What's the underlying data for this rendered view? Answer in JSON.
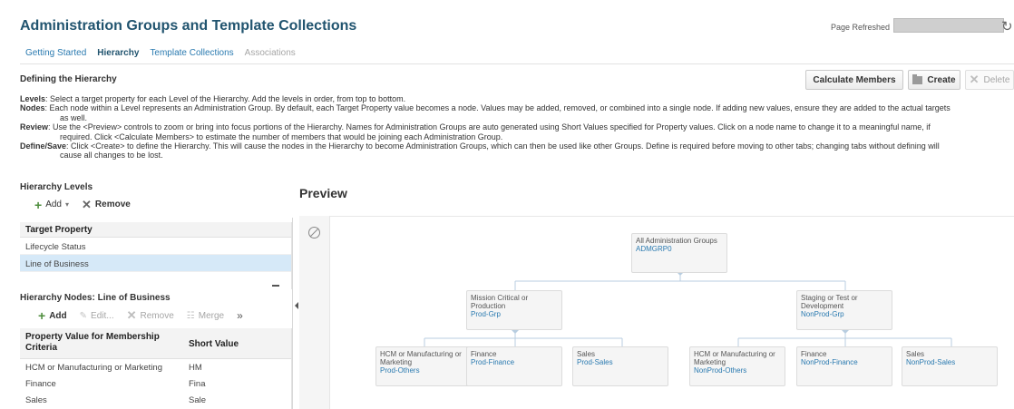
{
  "header": {
    "title": "Administration Groups and Template Collections",
    "page_refreshed_label": "Page Refreshed"
  },
  "tabs": [
    {
      "label": "Getting Started",
      "state": "normal"
    },
    {
      "label": "Hierarchy",
      "state": "active"
    },
    {
      "label": "Template Collections",
      "state": "normal"
    },
    {
      "label": "Associations",
      "state": "disabled"
    }
  ],
  "defining": {
    "title": "Defining the Hierarchy",
    "buttons": {
      "calculate": "Calculate Members",
      "create": "Create",
      "delete": "Delete"
    },
    "instructions": {
      "levels": {
        "term": "Levels",
        "text": ": Select a target property for each Level of the Hierarchy. Add the levels in order, from top to bottom."
      },
      "nodes": {
        "term": "Nodes",
        "text": ": Each node within a Level represents an Administration Group. By default, each Target Property value becomes a node. Values may be added, removed, or combined into a single node. If adding new values, ensure they are added to the actual targets",
        "cont": "as well."
      },
      "review": {
        "term": "Review",
        "text": ": Use the <Preview> controls to zoom or bring into focus portions of the Hierarchy. Names for Administration Groups are auto generated using Short Values specified for Property values. Click on a node name to change it to a meaningful name, if",
        "cont": "required. Click <Calculate Members> to estimate the number of members that would be joining each Administration Group."
      },
      "define": {
        "term": "Define/Save",
        "text": ": Click <Create> to define the Hierarchy. This will cause the nodes in the Hierarchy to become Administration Groups, which can then be used like other Groups. Define is required before moving to other tabs; changing tabs without defining will",
        "cont": "cause all changes to be lost."
      }
    }
  },
  "levels": {
    "title": "Hierarchy Levels",
    "toolbar": {
      "add": "Add",
      "remove": "Remove"
    },
    "column": "Target Property",
    "rows": [
      "Lifecycle Status",
      "Line of Business"
    ],
    "selected_index": 1
  },
  "nodes": {
    "title": "Hierarchy Nodes: Line of Business",
    "toolbar": {
      "add": "Add",
      "edit": "Edit...",
      "remove": "Remove",
      "merge": "Merge",
      "more": "»"
    },
    "columns": [
      "Property Value for Membership Criteria",
      "Short Value"
    ],
    "rows": [
      [
        "HCM or Manufacturing or Marketing",
        "HM"
      ],
      [
        "Finance",
        "Fina"
      ],
      [
        "Sales",
        "Sale"
      ]
    ]
  },
  "preview": {
    "title": "Preview",
    "root": {
      "name": "All Administration Groups",
      "id": "ADMGRP0"
    },
    "level1": [
      {
        "name": "Mission Critical or Production",
        "id": "Prod-Grp"
      },
      {
        "name": "Staging or Test or Development",
        "id": "NonProd-Grp"
      }
    ],
    "level2": [
      {
        "name": "HCM or Manufacturing or Marketing",
        "id": "Prod-Others"
      },
      {
        "name": "Finance",
        "id": "Prod-Finance"
      },
      {
        "name": "Sales",
        "id": "Prod-Sales"
      },
      {
        "name": "HCM or Manufacturing or Marketing",
        "id": "NonProd-Others"
      },
      {
        "name": "Finance",
        "id": "NonProd-Finance"
      },
      {
        "name": "Sales",
        "id": "NonProd-Sales"
      }
    ]
  },
  "colors": {
    "title": "#21546f",
    "link": "#2a7ab0",
    "selected_row": "#d6e9f8",
    "add_green": "#4e8e3e"
  }
}
